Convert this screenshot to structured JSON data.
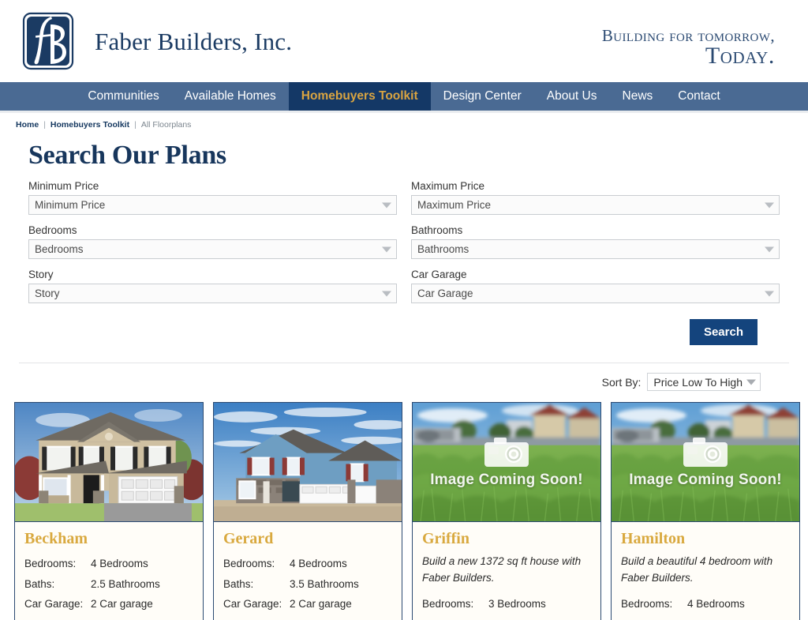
{
  "brand": {
    "logo_icon": "fb-monogram-logo",
    "name": "Faber Builders, Inc.",
    "tagline_line1": "Building for tomorrow,",
    "tagline_line2": "Today.",
    "navy": "#143866",
    "gold": "#d9a441",
    "nav_blue": "#4a6a93"
  },
  "nav": {
    "items": [
      {
        "label": "Communities",
        "active": false
      },
      {
        "label": "Available Homes",
        "active": false
      },
      {
        "label": "Homebuyers Toolkit",
        "active": true
      },
      {
        "label": "Design Center",
        "active": false
      },
      {
        "label": "About Us",
        "active": false
      },
      {
        "label": "News",
        "active": false
      },
      {
        "label": "Contact",
        "active": false
      }
    ]
  },
  "breadcrumb": {
    "items": [
      "Home",
      "Homebuyers Toolkit",
      "All Floorplans"
    ],
    "separator": "|"
  },
  "page": {
    "title": "Search Our Plans"
  },
  "search_form": {
    "fields": [
      {
        "label": "Minimum Price",
        "value": "Minimum Price",
        "name": "minimum-price"
      },
      {
        "label": "Maximum Price",
        "value": "Maximum Price",
        "name": "maximum-price"
      },
      {
        "label": "Bedrooms",
        "value": "Bedrooms",
        "name": "bedrooms"
      },
      {
        "label": "Bathrooms",
        "value": "Bathrooms",
        "name": "bathrooms"
      },
      {
        "label": "Story",
        "value": "Story",
        "name": "story"
      },
      {
        "label": "Car Garage",
        "value": "Car Garage",
        "name": "car-garage"
      }
    ],
    "submit_label": "Search"
  },
  "sort": {
    "label": "Sort By:",
    "value": "Price Low To High"
  },
  "results": {
    "cards": [
      {
        "name": "Beckham",
        "image_type": "house-photo-beige-two-story",
        "description": "",
        "specs": [
          {
            "label": "Bedrooms:",
            "value": "4 Bedrooms"
          },
          {
            "label": "Baths:",
            "value": "2.5 Bathrooms"
          },
          {
            "label": "Car Garage:",
            "value": "2 Car garage"
          }
        ]
      },
      {
        "name": "Gerard",
        "image_type": "house-photo-blue-stone-two-story",
        "description": "",
        "specs": [
          {
            "label": "Bedrooms:",
            "value": "4 Bedrooms"
          },
          {
            "label": "Baths:",
            "value": "3.5 Bathrooms"
          },
          {
            "label": "Car Garage:",
            "value": "2 Car garage"
          }
        ]
      },
      {
        "name": "Griffin",
        "image_type": "image-coming-soon-placeholder",
        "placeholder_text": "Image Coming Soon!",
        "description": "Build a new 1372 sq ft house with Faber Builders.",
        "specs": [
          {
            "label": "Bedrooms:",
            "value": "3 Bedrooms"
          }
        ]
      },
      {
        "name": "Hamilton",
        "image_type": "image-coming-soon-placeholder",
        "placeholder_text": "Image Coming Soon!",
        "description": "Build a beautiful 4 bedroom with Faber Builders.",
        "specs": [
          {
            "label": "Bedrooms:",
            "value": "4 Bedrooms"
          }
        ]
      }
    ]
  }
}
